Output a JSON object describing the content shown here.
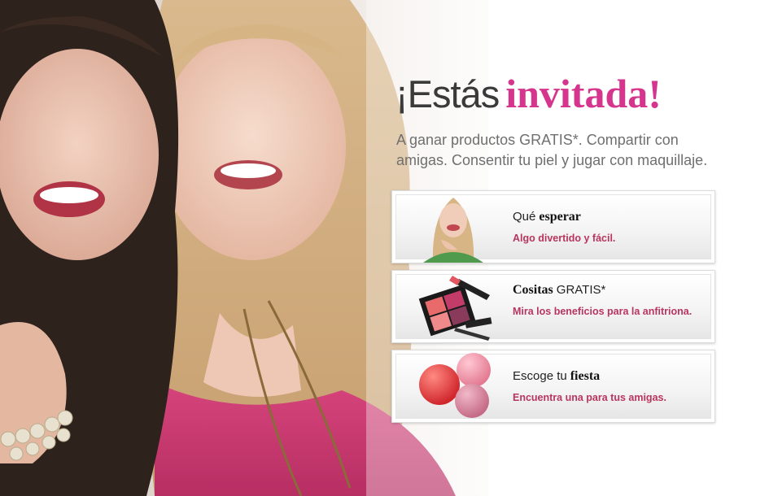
{
  "headline": {
    "prefix": "¡Estás",
    "accent": "invitada!"
  },
  "subtitle": "A ganar productos GRATIS*. Compartir con amigas. Consentir tu piel y jugar con maquillaje.",
  "colors": {
    "accent": "#d5358c",
    "link": "#b8355f",
    "body_text": "#6f6f6f"
  },
  "cards": [
    {
      "title_light": "Qué",
      "title_bold": "esperar",
      "description": "Algo divertido y fácil.",
      "icon": "woman-portrait-image"
    },
    {
      "title_bold": "Cositas",
      "title_light": "GRATIS*",
      "description": "Mira los beneficios para la anfitriona.",
      "icon": "makeup-palette-image"
    },
    {
      "title_light": "Escoge tu",
      "title_bold": "fiesta",
      "description": "Encuentra una para tus amigas.",
      "icon": "nail-polish-dots-image"
    }
  ]
}
